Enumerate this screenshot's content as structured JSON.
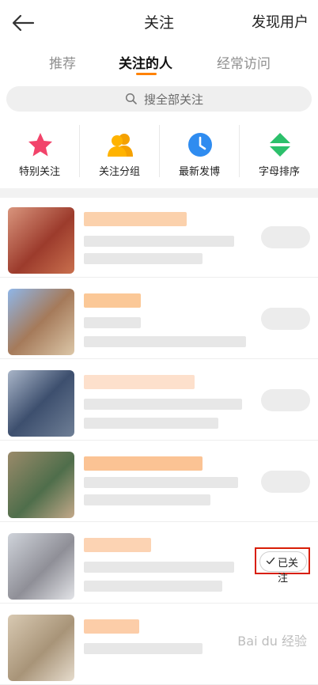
{
  "header": {
    "title": "关注",
    "discover_label": "发现用户"
  },
  "tabs": [
    {
      "label": "推荐"
    },
    {
      "label": "关注的人"
    },
    {
      "label": "经常访问"
    }
  ],
  "search": {
    "placeholder": "搜全部关注"
  },
  "quick_actions": [
    {
      "label": "特别关注",
      "icon": "star-icon"
    },
    {
      "label": "关注分组",
      "icon": "group-icon"
    },
    {
      "label": "最新发博",
      "icon": "clock-icon"
    },
    {
      "label": "字母排序",
      "icon": "sort-icon"
    }
  ],
  "follow_button": {
    "label": "已关注"
  },
  "colors": {
    "accent": "#ff8200",
    "highlight": "#d81e06"
  },
  "watermark": "Bai du 经验"
}
